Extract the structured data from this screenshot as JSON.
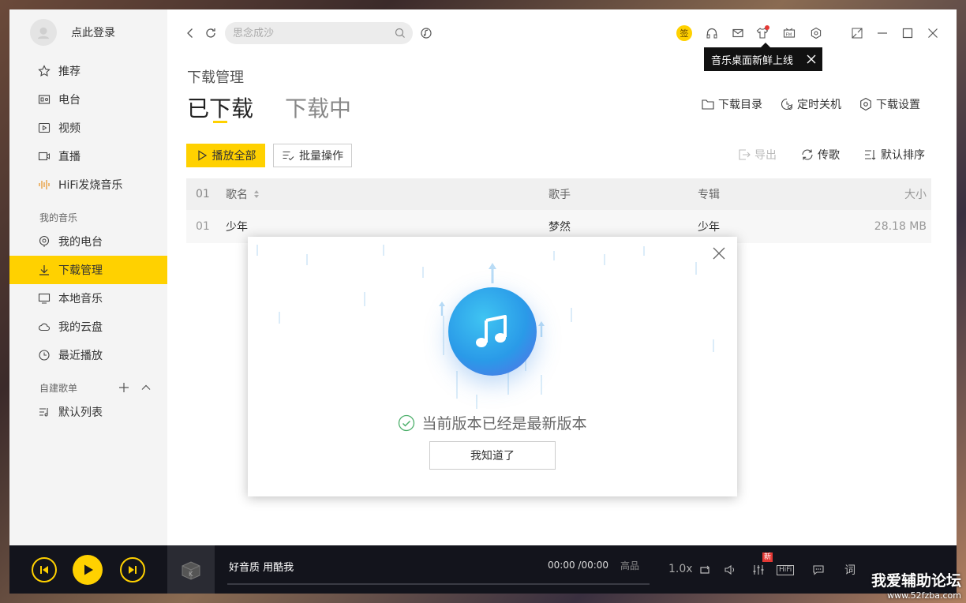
{
  "user": {
    "name": "点此登录"
  },
  "sidebar": {
    "items": [
      {
        "label": "推荐",
        "icon": "star-icon"
      },
      {
        "label": "电台",
        "icon": "radio-icon"
      },
      {
        "label": "视频",
        "icon": "video-icon"
      },
      {
        "label": "直播",
        "icon": "live-icon"
      },
      {
        "label": "HiFi发烧音乐",
        "icon": "soundwave-icon"
      }
    ],
    "my_music": {
      "title": "我的音乐",
      "items": [
        {
          "label": "我的电台",
          "icon": "radio-pin-icon"
        },
        {
          "label": "下载管理",
          "icon": "download-icon",
          "active": true
        },
        {
          "label": "本地音乐",
          "icon": "monitor-icon"
        },
        {
          "label": "我的云盘",
          "icon": "cloud-icon"
        },
        {
          "label": "最近播放",
          "icon": "clock-icon"
        }
      ]
    },
    "playlists": {
      "title": "自建歌单",
      "items": [
        {
          "label": "默认列表",
          "icon": "playlist-icon"
        }
      ]
    }
  },
  "search": {
    "placeholder": "思念成沙"
  },
  "topbar": {
    "sign_label": "签"
  },
  "tooltip": {
    "text": "音乐桌面新鲜上线"
  },
  "page": {
    "title": "下载管理",
    "tabs": [
      {
        "label": "已下载",
        "active": true
      },
      {
        "label": "下载中",
        "active": false
      }
    ],
    "actions": {
      "download_dir": "下载目录",
      "timer_shutdown": "定时关机",
      "download_settings": "下载设置"
    },
    "toolbar": {
      "play_all": "播放全部",
      "batch": "批量操作",
      "export": "导出",
      "transfer": "传歌",
      "sort": "默认排序"
    }
  },
  "table": {
    "headers": {
      "index": "01",
      "name": "歌名",
      "singer": "歌手",
      "album": "专辑",
      "size": "大小"
    },
    "rows": [
      {
        "index": "01",
        "name": "少年",
        "singer": "梦然",
        "album": "少年",
        "size": "28.18 MB"
      }
    ]
  },
  "dialog": {
    "status": "当前版本已经是最新版本",
    "ok_label": "我知道了"
  },
  "player": {
    "track": "好音质 用酷我",
    "time": "00:00 /00:00",
    "quality": "高品",
    "speed": "1.0x",
    "new_badge": "新",
    "hifi": "HiFi",
    "lyric": "词"
  },
  "watermark": {
    "line1": "我爱辅助论坛",
    "line2": "www.52fzba.com"
  },
  "colors": {
    "accent": "#ffd100",
    "player_bg": "#13141c",
    "sidebar_bg": "#f4f4f4"
  }
}
